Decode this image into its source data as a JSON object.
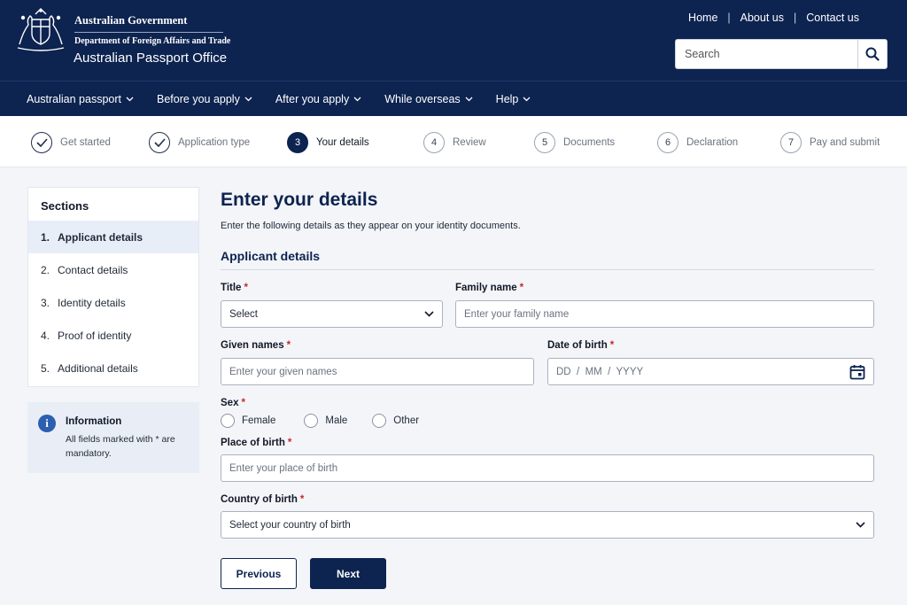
{
  "header": {
    "gov_name": "Australian Government",
    "department": "Department of Foreign Affairs and Trade",
    "office": "Australian Passport Office",
    "links": [
      "Home",
      "About us",
      "Contact us"
    ],
    "search_placeholder": "Search"
  },
  "nav": {
    "items": [
      "Australian passport",
      "Before you apply",
      "After you apply",
      "While overseas",
      "Help"
    ]
  },
  "stepper": {
    "steps": [
      {
        "num": "",
        "label": "Get started",
        "state": "done"
      },
      {
        "num": "",
        "label": "Application type",
        "state": "done"
      },
      {
        "num": "3",
        "label": "Your details",
        "state": "active"
      },
      {
        "num": "4",
        "label": "Review",
        "state": "pending"
      },
      {
        "num": "5",
        "label": "Documents",
        "state": "pending"
      },
      {
        "num": "6",
        "label": "Declaration",
        "state": "pending"
      },
      {
        "num": "7",
        "label": "Pay and submit",
        "state": "pending"
      }
    ]
  },
  "sidebar": {
    "title": "Sections",
    "items": [
      {
        "num": "1.",
        "label": "Applicant details",
        "active": true
      },
      {
        "num": "2.",
        "label": "Contact details",
        "active": false
      },
      {
        "num": "3.",
        "label": "Identity details",
        "active": false
      },
      {
        "num": "4.",
        "label": "Proof of identity",
        "active": false
      },
      {
        "num": "5.",
        "label": "Additional details",
        "active": false
      }
    ],
    "info": {
      "icon": "i",
      "title": "Information",
      "text": "All fields marked with * are mandatory."
    }
  },
  "form": {
    "heading": "Enter your details",
    "intro": "Enter the following details as they appear on your identity documents.",
    "section_title": "Applicant details",
    "required_mark": "*",
    "title_label": "Title",
    "title_value": "Select",
    "family_label": "Family name",
    "family_placeholder": "Enter your family name",
    "given_label": "Given names",
    "given_placeholder": "Enter your given names",
    "dob_label": "Date of birth",
    "dob_placeholder": "DD  /  MM  /  YYYY",
    "sex_label": "Sex",
    "sex_options": [
      "Female",
      "Male",
      "Other"
    ],
    "pob_label": "Place of birth",
    "pob_placeholder": "Enter your place of birth",
    "cob_label": "Country of birth",
    "cob_value": "Select your country of birth",
    "prev_label": "Previous",
    "next_label": "Next"
  },
  "colors": {
    "brand_navy": "#0d2350",
    "page_bg": "#f3f5f9",
    "required_red": "#c62828",
    "info_blue": "#2c5fb0"
  },
  "icons": [
    "crest-logo",
    "search-icon",
    "chevron-down-icon",
    "check-icon",
    "info-icon",
    "calendar-icon"
  ]
}
